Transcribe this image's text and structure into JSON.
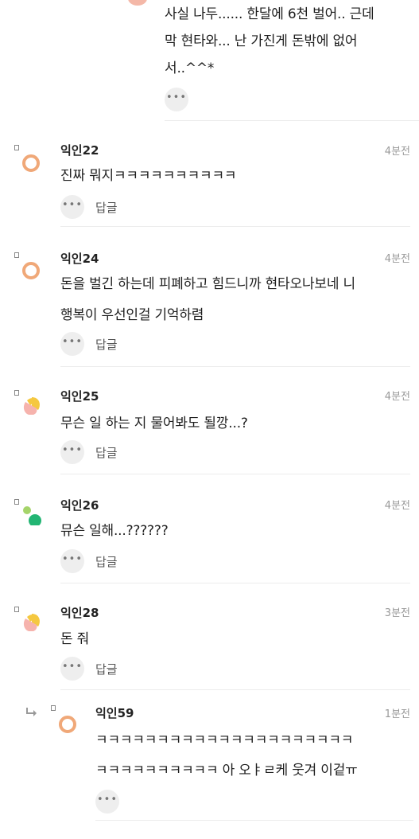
{
  "top_comment": {
    "lines": [
      "사실 나두...... 한달에 6천 벌어.. 근데",
      "막 현타와... 난 가진게 돈밖에 없어",
      "서..^^*"
    ],
    "more_icon": "ellipsis-icon"
  },
  "comments": [
    {
      "name": "익인22",
      "time": "4분전",
      "lines": [
        "진짜 뭐지ㅋㅋㅋㅋㅋㅋㅋㅋㅋㅋ"
      ],
      "reply_label": "답글",
      "avatar": "orange-ring-avatar"
    },
    {
      "name": "익인24",
      "time": "4분전",
      "lines": [
        "돈을 벌긴 하는데 피폐하고 힘드니까 현타오나보네 니",
        "행복이 우선인걸 기억하렴"
      ],
      "reply_label": "답글",
      "avatar": "orange-ring-avatar"
    },
    {
      "name": "익인25",
      "time": "4분전",
      "lines": [
        "무슨 일 하는 지 물어봐도 될깡...?"
      ],
      "reply_label": "답글",
      "avatar": "yellow-pink-avatar"
    },
    {
      "name": "익인26",
      "time": "4분전",
      "lines": [
        "뮤슨 일해...??????"
      ],
      "reply_label": "답글",
      "avatar": "green-dots-avatar"
    },
    {
      "name": "익인28",
      "time": "3분전",
      "lines": [
        "돈 줘"
      ],
      "reply_label": "답글",
      "avatar": "yellow-pink-avatar"
    }
  ],
  "nested_reply": {
    "name": "익인59",
    "time": "1분전",
    "lines": [
      "ㅋㅋㅋㅋㅋㅋㅋㅋㅋㅋㅋㅋㅋㅋㅋㅋㅋㅋㅋㅋㅋ",
      "ㅋㅋㅋㅋㅋㅋㅋㅋㅋㅋ 아 오ㅑㄹ케 웃겨 이겉ㅠ"
    ],
    "avatar": "orange-ring-avatar",
    "reply_arrow_icon": "reply-arrow-icon"
  }
}
